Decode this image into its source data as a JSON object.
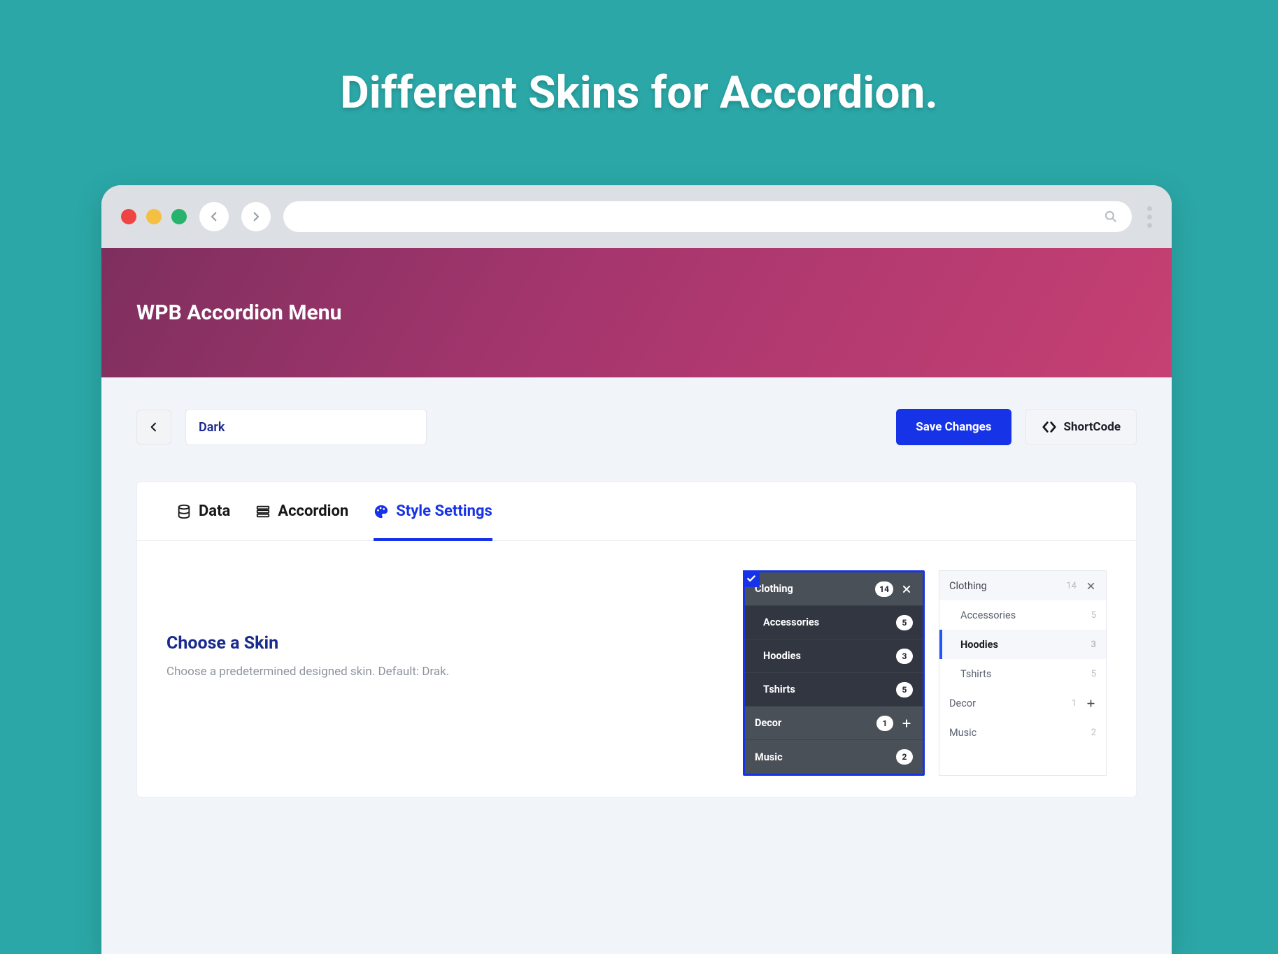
{
  "headline": "Different Skins for Accordion.",
  "app": {
    "title": "WPB Accordion Menu"
  },
  "toolbar": {
    "name_value": "Dark",
    "save_label": "Save Changes",
    "shortcode_label": "ShortCode"
  },
  "tabs": {
    "data": "Data",
    "accordion": "Accordion",
    "style": "Style Settings"
  },
  "section": {
    "title": "Choose a Skin",
    "desc": "Choose a predetermined designed skin. Default: Drak."
  },
  "skin_dark": {
    "rows": [
      {
        "label": "Clothing",
        "count": "14",
        "trail": "close",
        "level": "parent"
      },
      {
        "label": "Accessories",
        "count": "5",
        "level": "child"
      },
      {
        "label": "Hoodies",
        "count": "3",
        "level": "child"
      },
      {
        "label": "Tshirts",
        "count": "5",
        "level": "child"
      },
      {
        "label": "Decor",
        "count": "1",
        "trail": "plus",
        "level": "parent"
      },
      {
        "label": "Music",
        "count": "2",
        "level": "parent"
      }
    ]
  },
  "skin_light": {
    "rows": [
      {
        "label": "Clothing",
        "count": "14",
        "trail": "close",
        "level": "parent"
      },
      {
        "label": "Accessories",
        "count": "5",
        "level": "child"
      },
      {
        "label": "Hoodies",
        "count": "3",
        "level": "child",
        "active": true
      },
      {
        "label": "Tshirts",
        "count": "5",
        "level": "child"
      },
      {
        "label": "Decor",
        "count": "1",
        "trail": "plus",
        "level": "parent-plain"
      },
      {
        "label": "Music",
        "count": "2",
        "level": "parent-plain"
      }
    ]
  }
}
